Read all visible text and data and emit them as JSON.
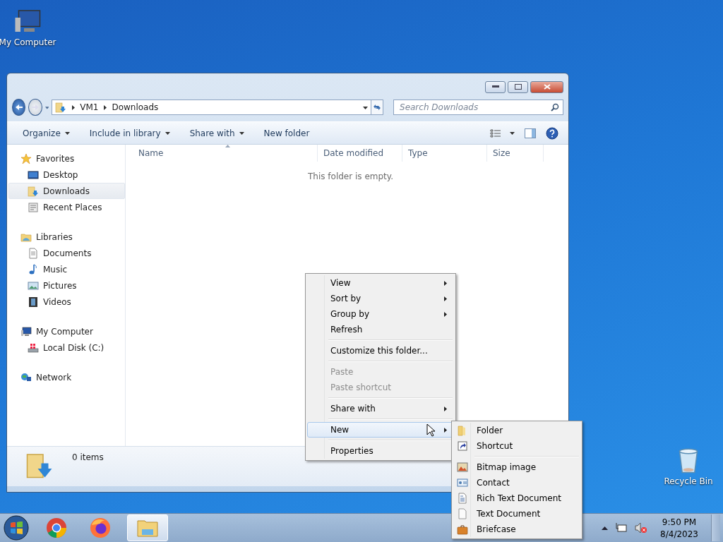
{
  "desktop_icons": [
    {
      "label": "My Computer",
      "kind": "computer"
    },
    {
      "label": "Recycle Bin",
      "kind": "bin"
    }
  ],
  "window": {
    "address": {
      "segments": [
        "VM1",
        "Downloads"
      ]
    },
    "search": {
      "placeholder": "Search Downloads"
    },
    "toolbar": [
      {
        "label": "Organize",
        "dropdown": true
      },
      {
        "label": "Include in library",
        "dropdown": true
      },
      {
        "label": "Share with",
        "dropdown": true
      },
      {
        "label": "New folder",
        "dropdown": false
      }
    ],
    "navigation": [
      {
        "label": "Favorites",
        "kind": "star",
        "children": [
          {
            "label": "Desktop",
            "kind": "desktop",
            "selected": false
          },
          {
            "label": "Downloads",
            "kind": "downloads",
            "selected": true
          },
          {
            "label": "Recent Places",
            "kind": "recent",
            "selected": false
          }
        ]
      },
      {
        "label": "Libraries",
        "kind": "library",
        "children": [
          {
            "label": "Documents",
            "kind": "document",
            "selected": false
          },
          {
            "label": "Music",
            "kind": "music",
            "selected": false
          },
          {
            "label": "Pictures",
            "kind": "pictures",
            "selected": false
          },
          {
            "label": "Videos",
            "kind": "videos",
            "selected": false
          }
        ]
      },
      {
        "label": "My Computer",
        "kind": "computer",
        "children": [
          {
            "label": "Local Disk (C:)",
            "kind": "disk",
            "selected": false
          }
        ]
      },
      {
        "label": "Network",
        "kind": "network"
      }
    ],
    "columns": [
      {
        "label": "Name",
        "sorted": true
      },
      {
        "label": "Date modified",
        "sorted": false
      },
      {
        "label": "Type",
        "sorted": false
      },
      {
        "label": "Size",
        "sorted": false
      }
    ],
    "empty_message": "This folder is empty.",
    "status": {
      "count": "0 items"
    }
  },
  "context_menu": {
    "items": [
      {
        "kind": "item",
        "label": "View",
        "submenu": true,
        "disabled": false,
        "selected": false
      },
      {
        "kind": "item",
        "label": "Sort by",
        "submenu": true,
        "disabled": false,
        "selected": false
      },
      {
        "kind": "item",
        "label": "Group by",
        "submenu": true,
        "disabled": false,
        "selected": false
      },
      {
        "kind": "item",
        "label": "Refresh",
        "submenu": false,
        "disabled": false,
        "selected": false
      },
      {
        "kind": "separator"
      },
      {
        "kind": "item",
        "label": "Customize this folder...",
        "submenu": false,
        "disabled": false,
        "selected": false
      },
      {
        "kind": "separator"
      },
      {
        "kind": "item",
        "label": "Paste",
        "submenu": false,
        "disabled": true,
        "selected": false
      },
      {
        "kind": "item",
        "label": "Paste shortcut",
        "submenu": false,
        "disabled": true,
        "selected": false
      },
      {
        "kind": "separator"
      },
      {
        "kind": "item",
        "label": "Share with",
        "submenu": true,
        "disabled": false,
        "selected": false
      },
      {
        "kind": "separator"
      },
      {
        "kind": "item",
        "label": "New",
        "submenu": true,
        "disabled": false,
        "selected": true
      },
      {
        "kind": "separator"
      },
      {
        "kind": "item",
        "label": "Properties",
        "submenu": false,
        "disabled": false,
        "selected": false
      }
    ]
  },
  "new_submenu": {
    "items": [
      {
        "kind": "item",
        "label": "Folder"
      },
      {
        "kind": "item",
        "label": "Shortcut"
      },
      {
        "kind": "separator"
      },
      {
        "kind": "item",
        "label": "Bitmap image"
      },
      {
        "kind": "item",
        "label": "Contact"
      },
      {
        "kind": "item",
        "label": "Rich Text Document"
      },
      {
        "kind": "item",
        "label": "Text Document"
      },
      {
        "kind": "item",
        "label": "Briefcase"
      }
    ]
  },
  "taskbar": {
    "apps": [
      {
        "kind": "chrome",
        "selected": false
      },
      {
        "kind": "firefox",
        "selected": false
      },
      {
        "kind": "explorer",
        "selected": true
      }
    ],
    "clock": {
      "time": "9:50 PM",
      "date": "8/4/2023"
    }
  }
}
